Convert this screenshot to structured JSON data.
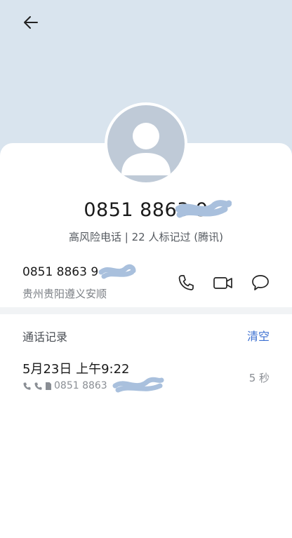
{
  "header": {
    "back_icon": "arrow-left-icon"
  },
  "contact": {
    "number": "0851 8863 9",
    "risk_tag": "高风险电话 | 22 人标记过 (腾讯)"
  },
  "number_row": {
    "number": "0851 8863 9",
    "location": "贵州贵阳遵义安顺",
    "actions": [
      "phone-icon",
      "video-icon",
      "message-icon"
    ]
  },
  "call_log": {
    "title": "通话记录",
    "clear_label": "清空",
    "items": [
      {
        "time": "5月23日 上午9:22",
        "number": "0851 8863",
        "duration": "5 秒"
      }
    ]
  },
  "colors": {
    "header_bg": "#d9e4ee",
    "accent": "#3b6fd1",
    "scribble": "#a9c0dd"
  }
}
